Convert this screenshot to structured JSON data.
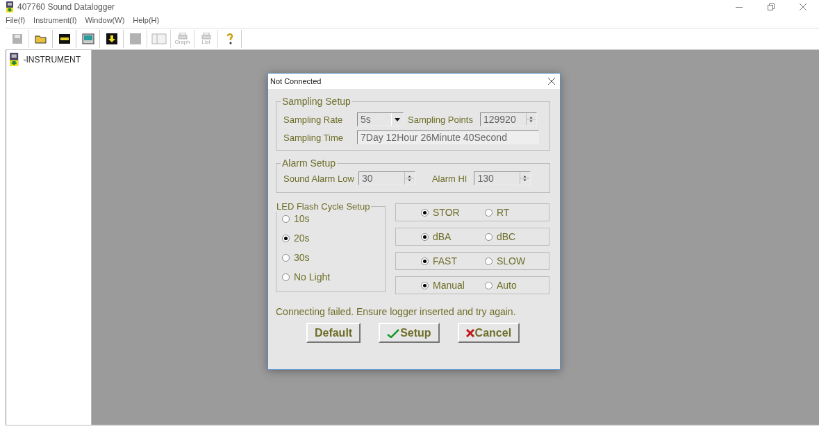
{
  "window": {
    "title": "407760 Sound Datalogger"
  },
  "menu": [
    {
      "label": "File(f)"
    },
    {
      "label": "Instrument(I)"
    },
    {
      "label": "Window(W)"
    },
    {
      "label": "Help(H)"
    }
  ],
  "toolbar": [
    {
      "kind": "save",
      "disabled": true
    },
    {
      "kind": "open",
      "disabled": false
    },
    {
      "kind": "meter",
      "disabled": false
    },
    {
      "kind": "monitor",
      "disabled": false
    },
    {
      "kind": "download",
      "disabled": false
    },
    {
      "kind": "stop",
      "disabled": true
    },
    {
      "kind": "book",
      "disabled": true
    },
    {
      "kind": "print",
      "label": "Graph",
      "disabled": true
    },
    {
      "kind": "print",
      "label": "List",
      "disabled": true
    },
    {
      "kind": "help",
      "disabled": false
    }
  ],
  "tree": {
    "items": [
      {
        "label": "-INSTRUMENT"
      }
    ]
  },
  "dialog": {
    "title": "Not Connected",
    "sampling": {
      "title": "Sampling Setup",
      "rate_label": "Sampling Rate",
      "rate": "5s",
      "points_label": "Sampling Points",
      "points": "129920",
      "time_label": "Sampling Time",
      "time": "7Day 12Hour 26Minute 40Second"
    },
    "alarm": {
      "title": "Alarm Setup",
      "low_label": "Sound Alarm Low",
      "low": "30",
      "hi_label": "Alarm HI",
      "hi": "130"
    },
    "led": {
      "title": "LED Flash Cycle Setup",
      "options": [
        {
          "label": "10s",
          "selected": false
        },
        {
          "label": "20s",
          "selected": true
        },
        {
          "label": "30s",
          "selected": false
        },
        {
          "label": "No Light",
          "selected": false
        }
      ]
    },
    "toggles": [
      {
        "options": [
          {
            "label": "STOR",
            "selected": true
          },
          {
            "label": "RT",
            "selected": false
          }
        ]
      },
      {
        "options": [
          {
            "label": "dBA",
            "selected": true
          },
          {
            "label": "dBC",
            "selected": false
          }
        ]
      },
      {
        "options": [
          {
            "label": "FAST",
            "selected": true
          },
          {
            "label": "SLOW",
            "selected": false
          }
        ]
      },
      {
        "options": [
          {
            "label": "Manual",
            "selected": true
          },
          {
            "label": "Auto",
            "selected": false
          }
        ]
      }
    ],
    "message": "Connecting failed. Ensure logger inserted and try again.",
    "buttons": [
      {
        "label": "Default",
        "kind": "plain"
      },
      {
        "label": "Setup",
        "kind": "check"
      },
      {
        "label": "Cancel",
        "kind": "cross"
      }
    ]
  }
}
